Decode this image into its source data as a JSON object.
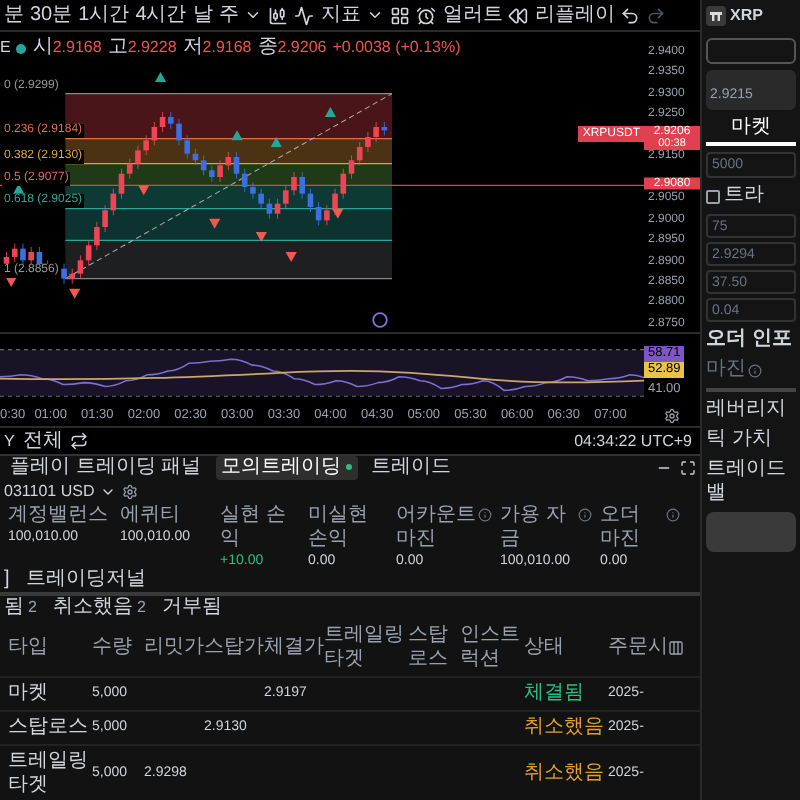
{
  "toolbar": {
    "intervals": [
      "분",
      "30분",
      "1시간",
      "4시간",
      "날",
      "주"
    ],
    "indicators": "지표",
    "alerts": "얼러트",
    "replay": "리플레이"
  },
  "symbol_line": {
    "cut_text": "E",
    "ohlc": [
      {
        "label": "시",
        "value": "2.9168"
      },
      {
        "label": "고",
        "value": "2.9228"
      },
      {
        "label": "저",
        "value": "2.9168"
      },
      {
        "label": "종",
        "value": "2.9206"
      }
    ],
    "change": "+0.0038 (+0.13%)"
  },
  "fib_levels": [
    {
      "label": "0 (2.9299)",
      "color": "#9a9a9a"
    },
    {
      "label": "0.236 (2.9184)",
      "color": "#e0704a"
    },
    {
      "label": "0.382 (2.9130)",
      "color": "#d6a93a"
    },
    {
      "label": "0.5 (2.9077)",
      "color": "#e06a6a"
    },
    {
      "label": "0.618 (2.9025)",
      "color": "#2aa79b"
    },
    {
      "label": "1 (2.8856)",
      "color": "#9a9a9a"
    }
  ],
  "price_axis": [
    "2.9400",
    "2.9350",
    "2.9300",
    "2.9250",
    "2.9150",
    "2.9050",
    "2.9000",
    "2.8950",
    "2.8900",
    "2.8850",
    "2.8800",
    "2.8750"
  ],
  "price_tags": [
    {
      "kind": "current",
      "symbol": "XRPUSDT",
      "price": "2.9206",
      "countdown": "00:38"
    },
    {
      "kind": "line",
      "price": "2.9080"
    }
  ],
  "oscillator": {
    "labels": [
      {
        "text": "58.71",
        "color": "#7e57c2"
      },
      {
        "text": "52.89",
        "color": "#e8c34a"
      },
      {
        "text": "41.00"
      }
    ]
  },
  "time_axis": [
    "0:30",
    "01:00",
    "01:30",
    "02:00",
    "02:30",
    "03:00",
    "03:30",
    "04:00",
    "04:30",
    "05:00",
    "05:30",
    "06:00",
    "06:30",
    "07:00"
  ],
  "chart_footer": {
    "range": "Y",
    "all": "전체",
    "clock": "04:34:22 UTC+9"
  },
  "panel": {
    "tabs": [
      {
        "label": "플레이 트레이딩 패널",
        "selected": false
      },
      {
        "label": "모의트레이딩",
        "selected": true
      },
      {
        "label": "트레이드",
        "selected": false
      }
    ],
    "account": "031101 USD",
    "stats": [
      {
        "label": "계정밸런스",
        "value": "100,010.00",
        "info": false,
        "color": "#d1d5db"
      },
      {
        "label": "에퀴티",
        "value": "100,010.00",
        "info": false,
        "color": "#d1d5db"
      },
      {
        "label": "실현 손익",
        "value": "+10.00",
        "info": false,
        "color": "#2ebd85"
      },
      {
        "label": "미실현 손익",
        "value": "0.00",
        "info": false,
        "color": "#d1d5db"
      },
      {
        "label": "어카운트 마진",
        "value": "0.00",
        "info": true,
        "color": "#d1d5db"
      },
      {
        "label": "가용 자금",
        "value": "100,010.00",
        "info": true,
        "color": "#d1d5db"
      },
      {
        "label": "오더 마진",
        "value": "0.00",
        "info": true,
        "color": "#d1d5db"
      }
    ],
    "sub_tabs": [
      "]",
      "트레이딩저널"
    ],
    "order_filters": [
      {
        "label": "됨",
        "count": "2"
      },
      {
        "label": "취소했음",
        "count": "2"
      },
      {
        "label": "거부됨"
      }
    ],
    "columns": [
      "타입",
      "수량",
      "리밋가",
      "스탑가",
      "체결가",
      "트레일링타겟",
      "스탑로스",
      "인스트럭션",
      "상태",
      "주문시"
    ],
    "rows": [
      {
        "type": "마켓",
        "qty": "5,000",
        "filled": "2.9197",
        "status": "체결됨",
        "color": "#2ebd85",
        "time": "2025-"
      },
      {
        "type": "스탑로스",
        "qty": "5,000",
        "stop": "2.9130",
        "status": "취소했음",
        "color": "#e0a030",
        "time": "2025-"
      },
      {
        "type": "트레일링타겟",
        "qty": "5,000",
        "limit": "2.9298",
        "status": "취소했음",
        "color": "#e0a030",
        "time": "2025-"
      }
    ]
  },
  "order_panel": {
    "symbol": "XRP",
    "price_box": "2.9215",
    "order_type": {
      "label": "마켓",
      "selected": true
    },
    "quantity": "5000",
    "trailing": {
      "label": "트라",
      "checked": false
    },
    "fields": [
      "75",
      "2.9294",
      "37.50",
      "0.04"
    ],
    "order_info": "오더 인포",
    "margin": "마진",
    "leverage": "레버리지",
    "tick_value": "틱 가치",
    "trade_value": "트레이드 밸"
  }
}
